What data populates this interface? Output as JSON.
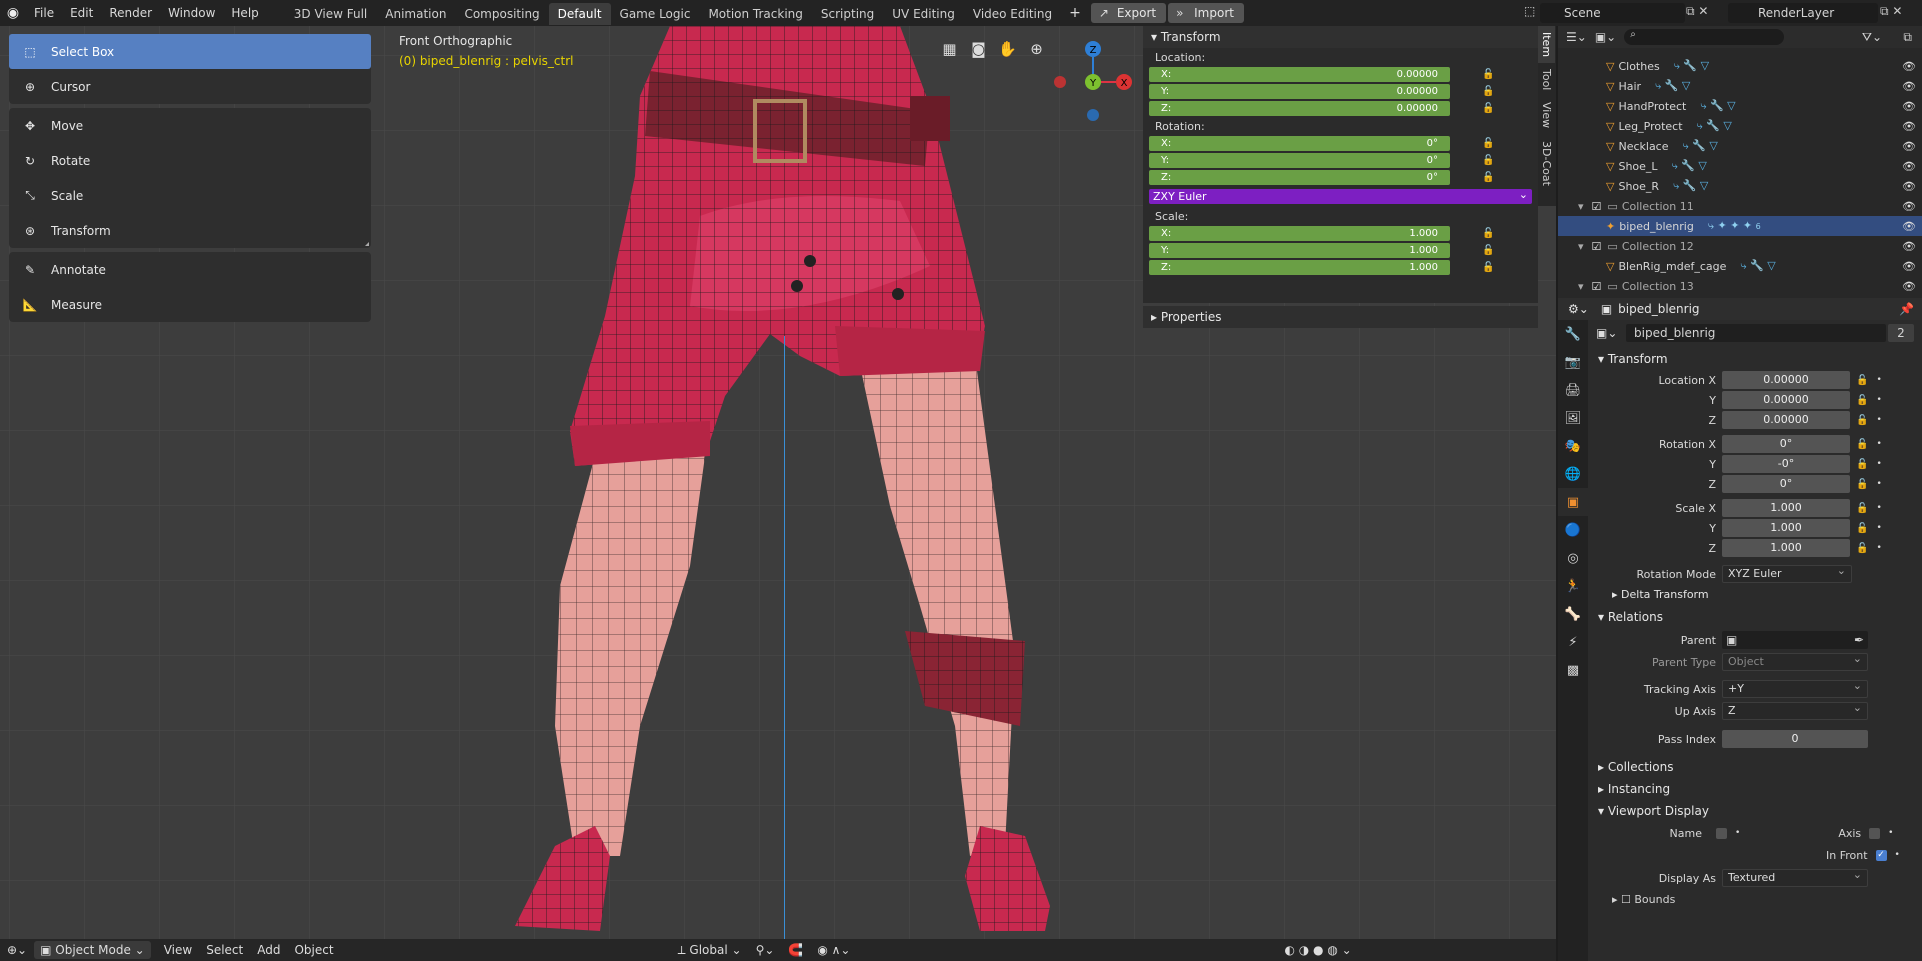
{
  "menubar": {
    "items": [
      "File",
      "Edit",
      "Render",
      "Window",
      "Help"
    ],
    "workspaces": [
      "3D View Full",
      "Animation",
      "Compositing",
      "Default",
      "Game Logic",
      "Motion Tracking",
      "Scripting",
      "UV Editing",
      "Video Editing"
    ],
    "active_workspace": "Default",
    "export_label": "Export",
    "import_label": "Import",
    "scene": "Scene",
    "render_layer": "RenderLayer"
  },
  "toolbar": {
    "tools": [
      "Select Box",
      "Cursor",
      "Move",
      "Rotate",
      "Scale",
      "Transform",
      "Annotate",
      "Measure"
    ],
    "active": "Select Box"
  },
  "viewport": {
    "view_name": "Front Orthographic",
    "object_info": "(0) biped_blenrig : pelvis_ctrl",
    "gizmo": {
      "z": "Z",
      "y": "Y",
      "x": "X"
    }
  },
  "npanel": {
    "title": "Transform",
    "location_label": "Location:",
    "location": [
      {
        "axis": "X:",
        "value": "0.00000"
      },
      {
        "axis": "Y:",
        "value": "0.00000"
      },
      {
        "axis": "Z:",
        "value": "0.00000"
      }
    ],
    "rotation_label": "Rotation:",
    "rotation": [
      {
        "axis": "X:",
        "value": "0°"
      },
      {
        "axis": "Y:",
        "value": "0°"
      },
      {
        "axis": "Z:",
        "value": "0°"
      }
    ],
    "rotation_mode": "ZXY Euler",
    "scale_label": "Scale:",
    "scale": [
      {
        "axis": "X:",
        "value": "1.000"
      },
      {
        "axis": "Y:",
        "value": "1.000"
      },
      {
        "axis": "Z:",
        "value": "1.000"
      }
    ],
    "properties_label": "Properties",
    "tabs": [
      "Item",
      "Tool",
      "View",
      "3D-Coat"
    ]
  },
  "bottombar": {
    "mode": "Object Mode",
    "menus": [
      "View",
      "Select",
      "Add",
      "Object"
    ],
    "orientation": "Global"
  },
  "outliner": {
    "rows": [
      {
        "name": "Clothes",
        "type": "mesh"
      },
      {
        "name": "Hair",
        "type": "mesh"
      },
      {
        "name": "HandProtect",
        "type": "mesh"
      },
      {
        "name": "Leg_Protect",
        "type": "mesh"
      },
      {
        "name": "Necklace",
        "type": "mesh"
      },
      {
        "name": "Shoe_L",
        "type": "mesh"
      },
      {
        "name": "Shoe_R",
        "type": "mesh"
      },
      {
        "name": "Collection 11",
        "type": "collection"
      },
      {
        "name": "biped_blenrig",
        "type": "armature"
      },
      {
        "name": "Collection 12",
        "type": "collection"
      },
      {
        "name": "BlenRig_mdef_cage",
        "type": "mesh"
      },
      {
        "name": "Collection 13",
        "type": "collection"
      }
    ],
    "selected_badge": "6"
  },
  "properties": {
    "object_name": "biped_blenrig",
    "datablock_name": "biped_blenrig",
    "users": "2",
    "transform_label": "Transform",
    "location": [
      {
        "label": "Location X",
        "value": "0.00000"
      },
      {
        "label": "Y",
        "value": "0.00000"
      },
      {
        "label": "Z",
        "value": "0.00000"
      }
    ],
    "rotation": [
      {
        "label": "Rotation X",
        "value": "0°"
      },
      {
        "label": "Y",
        "value": "-0°"
      },
      {
        "label": "Z",
        "value": "0°"
      }
    ],
    "scale": [
      {
        "label": "Scale X",
        "value": "1.000"
      },
      {
        "label": "Y",
        "value": "1.000"
      },
      {
        "label": "Z",
        "value": "1.000"
      }
    ],
    "rotation_mode_label": "Rotation Mode",
    "rotation_mode": "XYZ Euler",
    "delta_label": "Delta Transform",
    "relations_label": "Relations",
    "parent_label": "Parent",
    "parent_type_label": "Parent Type",
    "parent_type": "Object",
    "tracking_axis_label": "Tracking Axis",
    "tracking_axis": "+Y",
    "up_axis_label": "Up Axis",
    "up_axis": "Z",
    "pass_index_label": "Pass Index",
    "pass_index": "0",
    "collections_label": "Collections",
    "instancing_label": "Instancing",
    "viewport_display_label": "Viewport Display",
    "name_label": "Name",
    "axis_label": "Axis",
    "in_front_label": "In Front",
    "display_as_label": "Display As",
    "display_as": "Textured",
    "bounds_label": "Bounds"
  },
  "colors": {
    "accent": "#5680c2",
    "green_field": "#6a9f45",
    "euler_purple": "#7d1fc2",
    "selection": "#334d80"
  }
}
